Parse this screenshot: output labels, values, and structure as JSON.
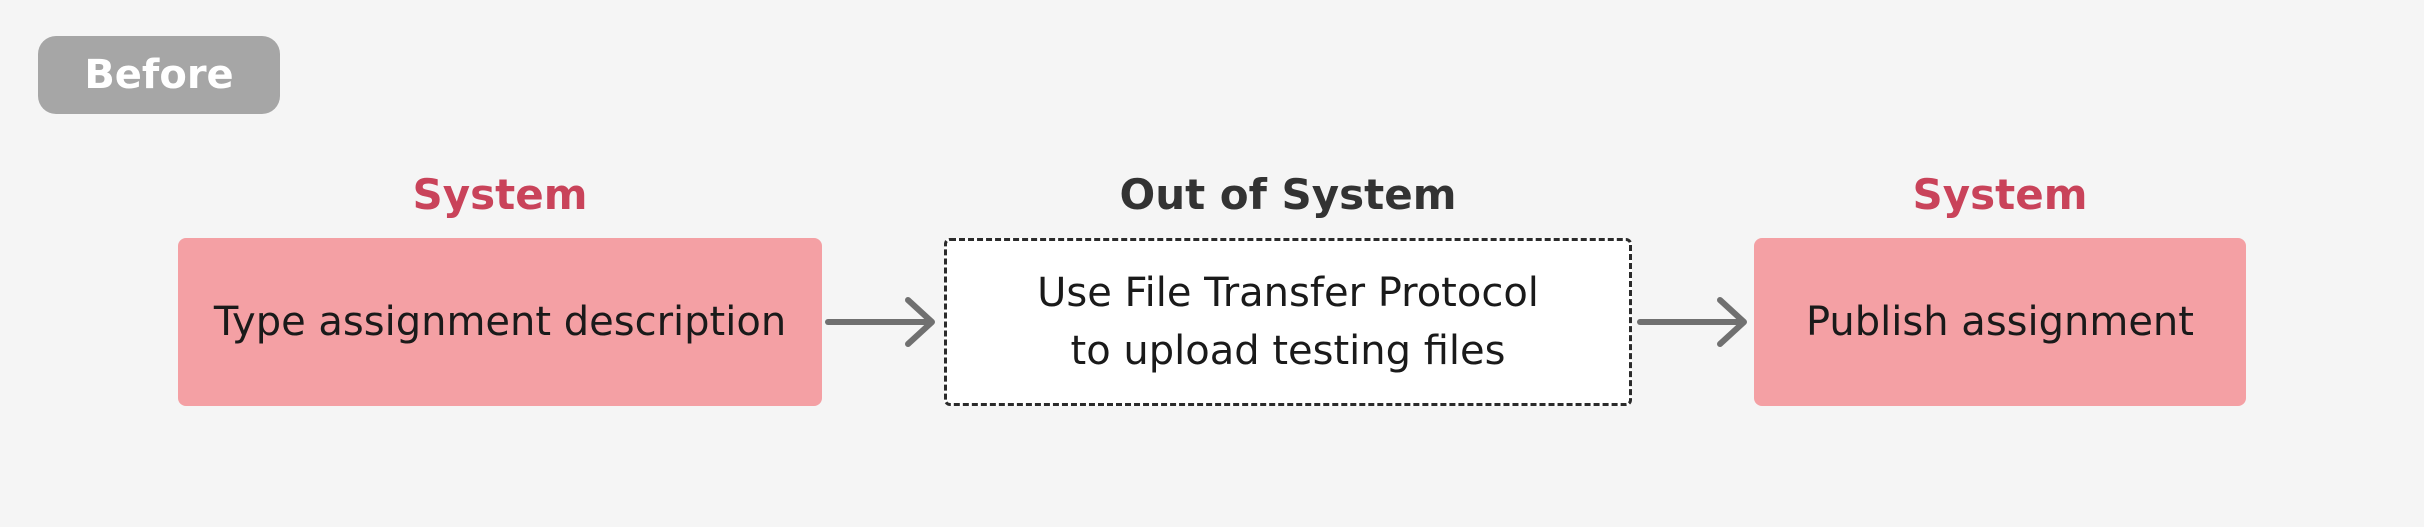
{
  "badge": {
    "label": "Before"
  },
  "colors": {
    "background": "#f5f5f5",
    "badge_bg": "#a6a6a6",
    "system_heading": "#c9435a",
    "external_heading": "#333333",
    "system_box": "#f4a0a4",
    "external_box": "#ffffff",
    "arrow": "#707070"
  },
  "steps": [
    {
      "heading": "System",
      "text": "Type assignment description",
      "kind": "system"
    },
    {
      "heading": "Out of System",
      "text": "Use File Transfer Protocol\nto upload testing files",
      "kind": "external"
    },
    {
      "heading": "System",
      "text": "Publish assignment",
      "kind": "system"
    }
  ]
}
